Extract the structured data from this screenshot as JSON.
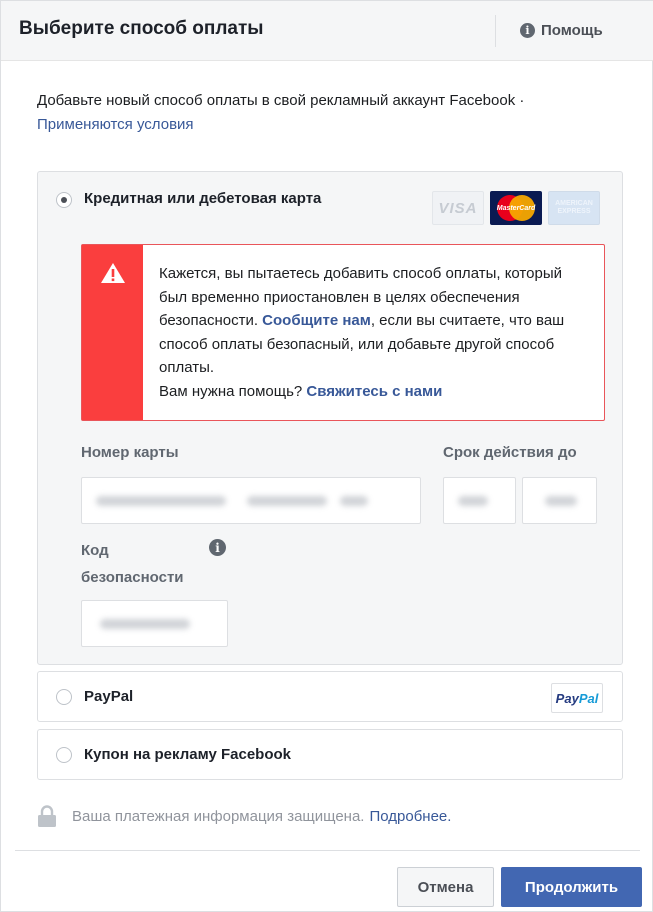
{
  "dialog": {
    "title": "Выберите способ оплаты",
    "help_label": "Помощь",
    "help_icon": "info-icon"
  },
  "intro": {
    "text": "Добавьте новый способ оплаты в свой рекламный аккаунт Facebook ·",
    "terms_link": "Применяются условия"
  },
  "payment_options": {
    "card": {
      "label": "Кредитная или дебетовая карта",
      "selected": true,
      "logos": {
        "visa": "VISA",
        "mastercard": "MasterCard",
        "amex": "AMERICAN EXPRESS"
      }
    },
    "paypal": {
      "label": "PayPal",
      "selected": false,
      "logo_part1": "Pay",
      "logo_part2": "Pal"
    },
    "coupon": {
      "label": "Купон на рекламу Facebook",
      "selected": false
    }
  },
  "alert": {
    "icon": "warning-icon",
    "text_before_link": "Кажется, вы пытаетесь добавить способ оплаты, который был временно приостановлен в целях обеспечения безопасности. ",
    "report_link": "Сообщите нам",
    "text_after_link": ", если вы считаете, что ваш способ оплаты безопасный, или добавьте другой способ оплаты.",
    "help_question": "Вам нужна помощь? ",
    "contact_link": "Свяжитесь с нами"
  },
  "form": {
    "card_number_label": "Номер карты",
    "expiry_label": "Срок действия до",
    "security_code_label_line1": "Код",
    "security_code_label_line2": "безопасности"
  },
  "security_note": {
    "text": "Ваша платежная информация защищена.",
    "more_link": "Подробнее."
  },
  "buttons": {
    "cancel": "Отмена",
    "continue": "Продолжить"
  },
  "colors": {
    "accent": "#4267b2",
    "link": "#385898",
    "alert": "#fa3e3e"
  }
}
